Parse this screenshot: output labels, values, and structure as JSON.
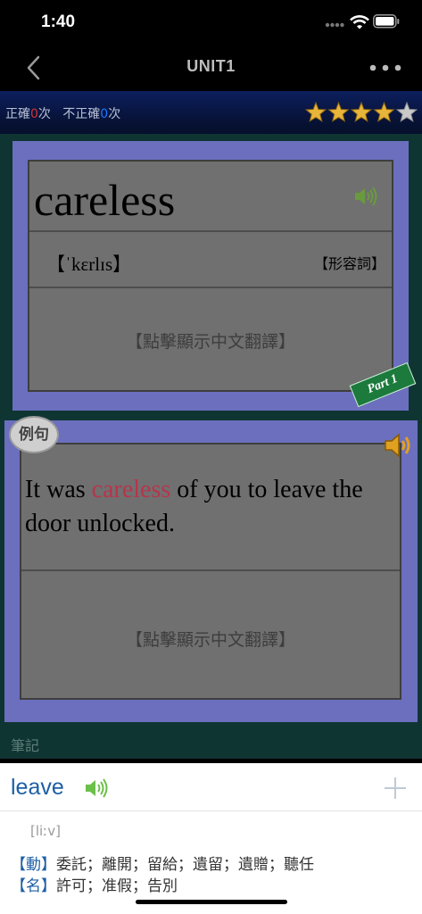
{
  "status_bar": {
    "time": "1:40"
  },
  "nav": {
    "title": "UNIT1"
  },
  "score": {
    "correct_label": "正確",
    "correct_count": "0",
    "times1": "次",
    "incorrect_label": "不正確",
    "incorrect_count": "0",
    "times2": "次",
    "rating": 4,
    "rating_max": 5
  },
  "word_card": {
    "word": "careless",
    "phonetic": "【ˈkɛrlɪs】",
    "part_of_speech": "【形容詞】",
    "tap_hint": "【點擊顯示中文翻譯】",
    "part_badge": "Part 1"
  },
  "example_card": {
    "badge": "例句",
    "sentence_before": "It was ",
    "sentence_highlight": "careless",
    "sentence_after": " of you to leave the door unlocked.",
    "tap_hint": "【點擊顯示中文翻譯】"
  },
  "notes_label": "筆記",
  "dictionary": {
    "word": "leave",
    "ipa": "[liːv]",
    "definitions": [
      {
        "tag": "【動】",
        "text": "委託；離開；留給；遺留；遺贈；聽任"
      },
      {
        "tag": "【名】",
        "text": "許可；准假；告別"
      }
    ]
  },
  "colors": {
    "accent": "#1d5fa6",
    "highlight": "#b8344b",
    "star": "#e8b53a",
    "card_frame": "#6b6fbe",
    "background": "#0f3533"
  }
}
